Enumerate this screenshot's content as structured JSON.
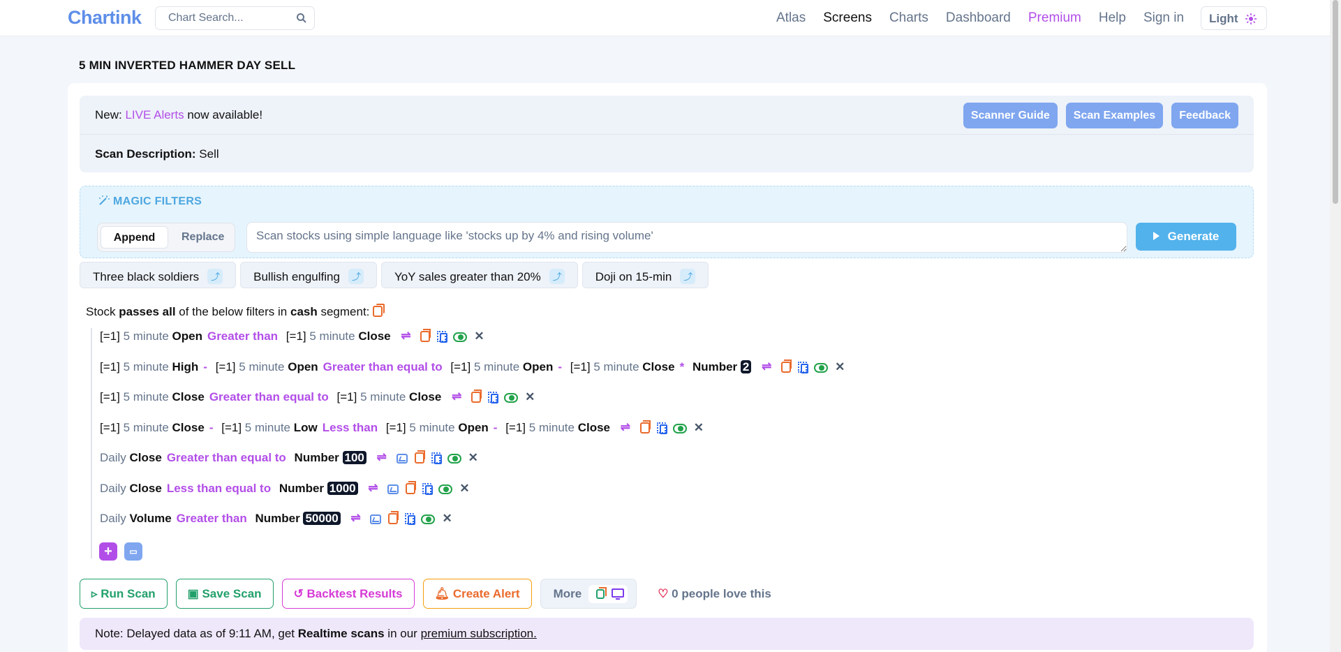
{
  "nav": {
    "logo": "Chartink",
    "search_placeholder": "Chart Search...",
    "links": [
      "Atlas",
      "Screens",
      "Charts",
      "Dashboard",
      "Premium",
      "Help",
      "Sign in"
    ],
    "theme_label": "Light"
  },
  "page_title": "5 MIN INVERTED HAMMER DAY SELL",
  "info": {
    "news_prefix": "New:",
    "news_link": "LIVE Alerts",
    "news_suffix": "now available!",
    "buttons": [
      "Scanner Guide",
      "Scan Examples",
      "Feedback"
    ],
    "desc_label": "Scan Description:",
    "desc_value": "Sell"
  },
  "magic": {
    "title": "MAGIC FILTERS",
    "mode_append": "Append",
    "mode_replace": "Replace",
    "placeholder": "Scan stocks using simple language like 'stocks up by 4% and rising volume'",
    "generate": "Generate",
    "suggestions": [
      "Three black soldiers",
      "Bullish engulfing",
      "YoY sales greater than 20%",
      "Doji on 15-min"
    ]
  },
  "filter_intro": {
    "a": "Stock",
    "b": "passes all",
    "c": "of the below filters in",
    "d": "cash",
    "e": "segment:"
  },
  "tokens": {
    "off": "[=1]",
    "tf": "5 minute",
    "daily": "Daily",
    "open": "Open",
    "close": "Close",
    "high": "High",
    "low": "Low",
    "volume": "Volume",
    "number": "Number",
    "gt": "Greater than",
    "gte": "Greater than equal to",
    "lt": "Less than",
    "lte": "Less than equal to",
    "minus": "-",
    "times": "*",
    "x": "✕"
  },
  "values": {
    "n2": "2",
    "n100": "100",
    "n1000": "1000",
    "n50000": "50000"
  },
  "actions": {
    "run": "Run Scan",
    "save": "Save Scan",
    "backtest": "Backtest Results",
    "alert": "Create Alert",
    "more": "More",
    "love": "0 people love this"
  },
  "note": {
    "a": "Note: Delayed data as of 9:11 AM, get",
    "b": "Realtime scans",
    "c": "in our",
    "d": "premium subscription."
  },
  "colors": {
    "accent_purple": "#b24ee8",
    "accent_blue": "#5e8ee8",
    "generate_blue": "#52b2ec"
  }
}
